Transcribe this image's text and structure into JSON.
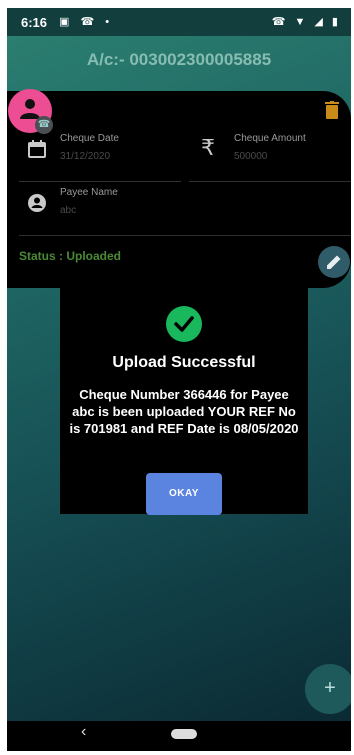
{
  "status_bar": {
    "time": "6:16",
    "left_icons": "▣ ☎ •",
    "right_icons": "☎ ▼ ◢ ▮"
  },
  "header": {
    "account_title": "A/c:- 003002300005885"
  },
  "cheque_card": {
    "cheque_date": {
      "label": "Cheque Date",
      "value": "31/12/2020",
      "icon": "calendar-icon"
    },
    "cheque_amount": {
      "label": "Cheque Amount",
      "value": "500000",
      "icon": "rupee-icon"
    },
    "payee_name": {
      "label": "Payee Name",
      "value": "abc",
      "icon": "person-icon"
    },
    "status": "Status : Uploaded"
  },
  "dialog": {
    "icon": "check-circle-icon",
    "title": "Upload Successful",
    "message": "Cheque Number 366446 for Payee abc is been uploaded YOUR REF No is 701981 and REF Date is 08/05/2020",
    "ok_label": "OKAY"
  },
  "fab": {
    "add_label": "+"
  },
  "nav": {
    "back_label": "‹"
  },
  "colors": {
    "accent_pink": "#ec4d93",
    "success_green": "#19b85d",
    "button_blue": "#5a84e0",
    "status_green": "#4a8a34",
    "title_teal": "#87bdb1"
  }
}
